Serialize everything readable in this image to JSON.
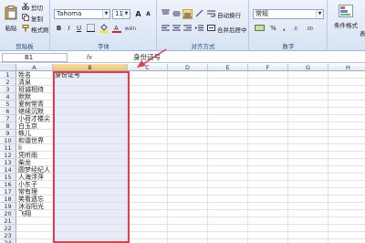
{
  "ribbon": {
    "clipboard": {
      "paste_label": "粘贴",
      "cut_label": "剪切",
      "copy_label": "复制",
      "format_painter_label": "格式刷",
      "group_label": "剪贴板"
    },
    "font": {
      "font_name": "Tahoma",
      "font_size": "11",
      "grow_label": "A",
      "shrink_label": "A",
      "bold": "B",
      "italic": "I",
      "underline": "U",
      "wen_label": "wén",
      "group_label": "字体"
    },
    "alignment": {
      "wrap_text_label": "自动换行",
      "merge_label": "合并后居中",
      "group_label": "对齐方式"
    },
    "number": {
      "format_value": "常规",
      "percent": "%",
      "comma": ",",
      "group_label": "数字"
    },
    "styles": {
      "conditional_label": "条件格式",
      "format_as_label": "表"
    }
  },
  "formula_bar": {
    "name_box": "B1",
    "fx": "fx",
    "content": "身份证号"
  },
  "grid": {
    "columns": [
      "A",
      "B",
      "C",
      "D",
      "E",
      "F",
      "G",
      "H",
      "I"
    ],
    "selected_column": "B",
    "rows": [
      "1",
      "2",
      "3",
      "4",
      "5",
      "6",
      "7",
      "8",
      "9",
      "10",
      "11",
      "12",
      "13",
      "14",
      "15",
      "16",
      "17",
      "18",
      "19",
      "20",
      "21",
      "22",
      "23",
      "24"
    ],
    "col_a": [
      "姓名",
      "清泉",
      "班诚相待",
      "默默",
      "爱树常青",
      "继续沉默",
      "小荷才楼尖",
      "白玉京",
      "蛛儿",
      "和谐世界",
      "li",
      "凭听雨",
      "柴龙",
      "圆梦经纪人",
      "人海浮萍",
      "小东子",
      "常有理",
      "笑看遗忘",
      "沐浴阳光",
      "飞翔",
      "",
      "",
      "",
      ""
    ],
    "col_b": [
      "身份证号",
      "",
      "",
      "",
      "",
      "",
      "",
      "",
      "",
      "",
      "",
      "",
      "",
      "",
      "",
      "",
      "",
      "",
      "",
      "",
      "",
      "",
      "",
      ""
    ]
  },
  "colors": {
    "selection_border": "#e0404c",
    "arrow": "#e0404c"
  }
}
